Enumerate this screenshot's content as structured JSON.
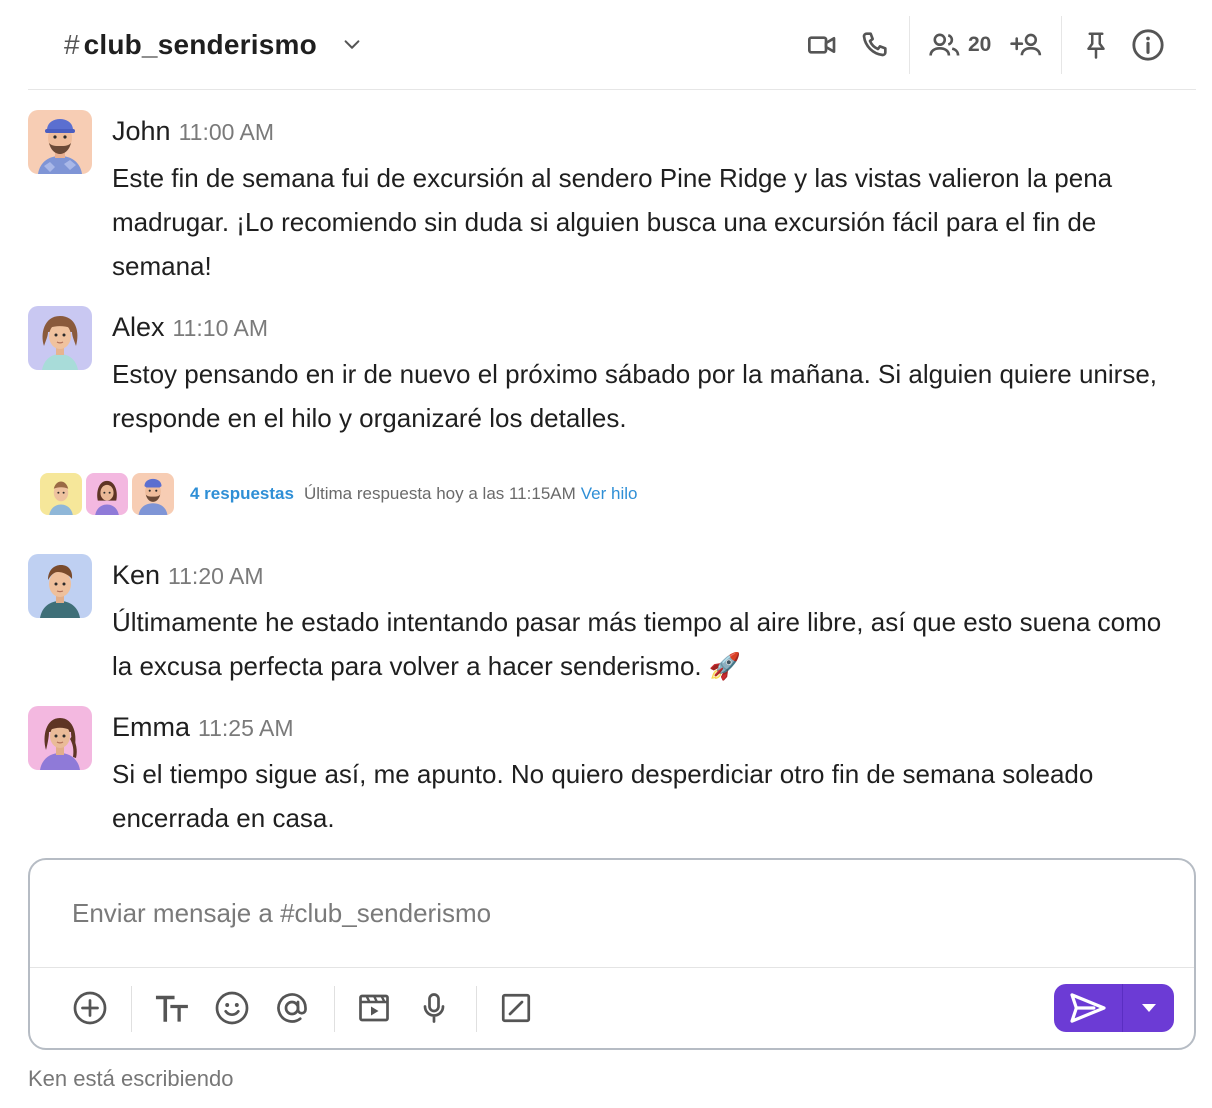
{
  "header": {
    "hash": "#",
    "channel_name": "club_senderismo",
    "member_count": "20",
    "icons": [
      "chevron-down-icon",
      "video-icon",
      "phone-icon",
      "members-icon",
      "add-member-icon",
      "pin-icon",
      "info-icon"
    ]
  },
  "messages": [
    {
      "author": "John",
      "time": "11:00 AM",
      "text": "Este fin de semana fui de excursión al sendero Pine Ridge y las vistas valieron la pena madrugar. ¡Lo recomiendo sin duda si alguien busca una excursión fácil para el fin de semana!"
    },
    {
      "author": "Alex",
      "time": "11:10 AM",
      "text": "Estoy pensando en ir de nuevo el próximo sábado por la mañana. Si alguien quiere unirse, responde en el hilo y organizaré los detalles."
    },
    {
      "author": "Ken",
      "time": "11:20 AM",
      "text": "Últimamente he estado intentando pasar más tiempo al aire libre, así que esto suena como la excusa perfecta para volver a hacer senderismo. 🚀"
    },
    {
      "author": "Emma",
      "time": "11:25 AM",
      "text": "Si el tiempo sigue así, me apunto. No quiero desperdiciar otro fin de semana soleado encerrada en casa."
    }
  ],
  "thread": {
    "replies": "4 respuestas",
    "last_reply": "Última respuesta hoy a las 11:15AM",
    "view": "Ver hilo"
  },
  "composer": {
    "placeholder": "Enviar mensaje a #club_senderismo",
    "value": "",
    "tools": [
      "add-icon",
      "text-format-icon",
      "emoji-icon",
      "mention-icon",
      "video-clip-icon",
      "microphone-icon",
      "slash-command-icon"
    ]
  },
  "typing_indicator": "Ken está escribiendo",
  "colors": {
    "accent": "#6c3bd5",
    "link": "#2f8fd6",
    "border": "#b6bcc4"
  }
}
